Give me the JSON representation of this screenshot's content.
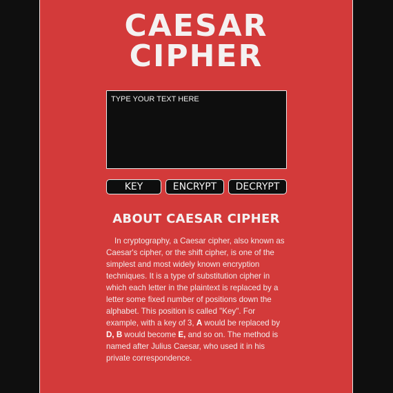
{
  "title": {
    "line1": "CAESAR",
    "line2": "CIPHER"
  },
  "input": {
    "placeholder": "TYPE YOUR TEXT HERE"
  },
  "buttons": {
    "key": "KEY",
    "encrypt": "ENCRYPT",
    "decrypt": "DECRYPT"
  },
  "about": {
    "heading": "ABOUT CAESAR CIPHER",
    "p1": "In cryptography, a Caesar cipher, also known as Caesar's cipher, or the shift cipher, is one of the simplest and most widely known encryption techniques. It is a type of substitution cipher in which each letter in the plaintext is replaced by a letter some fixed number of positions down the alphabet. This position is called \"Key\". For example, with a key of 3, ",
    "b1": "A",
    "p2": " would be replaced by ",
    "b2": "D, B",
    "p3": " would become ",
    "b3": "E,",
    "p4": " and so on. The method is named after Julius Caesar, who used it in his private correspondence."
  },
  "colors": {
    "background": "#0f0f0f",
    "panel": "#d33a3a",
    "input_bg": "#0e0e0e",
    "text": "#f4f1f1"
  }
}
